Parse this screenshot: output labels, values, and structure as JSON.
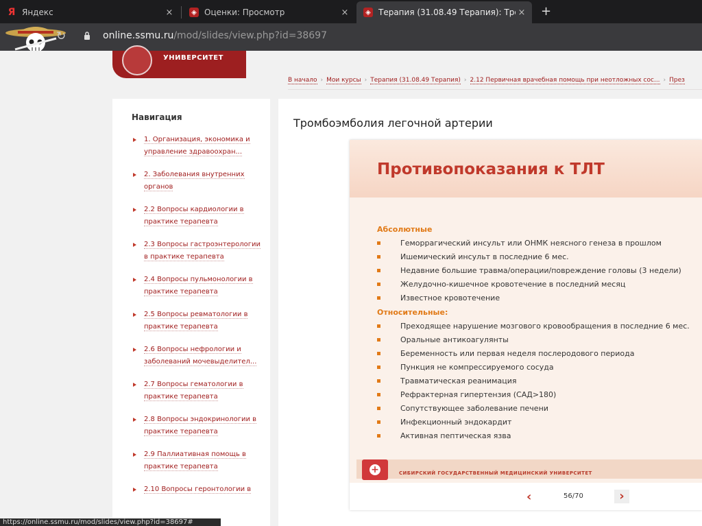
{
  "browser": {
    "tabs": [
      {
        "title": "Яндекс",
        "icon": "yandex-icon"
      },
      {
        "title": "Оценки: Просмотр",
        "icon": "ssmu-favicon"
      },
      {
        "title": "Терапия (31.08.49 Терапия): Тро",
        "icon": "ssmu-favicon"
      }
    ],
    "new_tab": "+",
    "close": "×",
    "url_host": "online.ssmu.ru",
    "url_path": "/mod/slides/view.php?id=38697",
    "status_url": "https://online.ssmu.ru/mod/slides/view.php?id=38697#"
  },
  "site": {
    "logo_text": "УНИВЕРСИТЕТ"
  },
  "breadcrumbs": [
    "В начало",
    "Мои курсы",
    "Терапия (31.08.49 Терапия)",
    "2.12 Первичная врачебная помощь при неотложных сос...",
    "През"
  ],
  "navigation": {
    "title": "Навигация",
    "items": [
      "1. Организация, экономика и управление здравоохран...",
      "2. Заболевания внутренних органов",
      "2.2 Вопросы кардиологии в практике терапевта",
      "2.3 Вопросы гастроэнтерологии в практике терапевта",
      "2.4 Вопросы пульмонологии в практике терапевта",
      "2.5 Вопросы ревматологии в практике терапевта",
      "2.6 Вопросы нефрологии и заболеваний мочевыделител...",
      "2.7 Вопросы гематологии в практике терапевта",
      "2.8 Вопросы эндокринологии в практике терапевта",
      "2.9 Паллиативная помощь в практике терапевта",
      "2.10 Вопросы геронтологии в"
    ]
  },
  "main": {
    "title": "Тромбоэмболия легочной артерии"
  },
  "slide": {
    "title": "Противопоказания к ТЛТ",
    "absolute_label": "Абсолютные",
    "absolute_items": [
      "Геморрагический инсульт или ОНМК неясного генеза в прошлом",
      "Ишемический инсульт в последние 6 мес.",
      "Недавние большие травма/операции/повреждение головы (3 недели)",
      "Желудочно-кишечное кровотечение в последний месяц",
      "Известное кровотечение"
    ],
    "relative_label": "Относительные:",
    "relative_items": [
      "Преходящее нарушение мозгового кровообращения в последние 6 мес.",
      "Оральные антикоагулянты",
      "Беременность или первая неделя послеродового периода",
      "Пункция не компрессируемого сосуда",
      "Травматическая реанимация",
      "Рефрактерная гипертензия (САД>180)",
      "Сопутствующее заболевание печени",
      "Инфекционный эндокардит",
      "Активная пептическая язва"
    ],
    "footer_text": "СИБИРСКИЙ ГОСУДАРСТВЕННЫЙ МЕДИЦИНСКИЙ УНИВЕРСИТЕТ"
  },
  "pager": {
    "prev": "‹",
    "next": "›",
    "counter": "56/70"
  },
  "colors": {
    "brand": "#9d1f20",
    "accent_orange": "#e17a17",
    "slide_title": "#c0392b"
  }
}
